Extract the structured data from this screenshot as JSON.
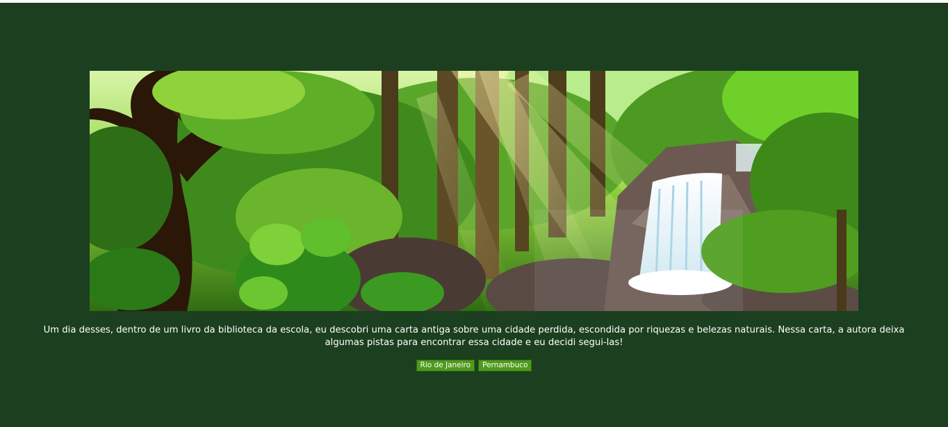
{
  "page": {
    "background": "#1c3f1f"
  },
  "illustration": {
    "description_icon": "rainforest-waterfall-image"
  },
  "story": {
    "text": "Um dia desses, dentro de um livro da biblioteca da escola, eu descobri uma carta antiga sobre uma cidade perdida, escondida por riquezas e belezas naturais. Nessa carta, a autora deixa algumas pistas para encontrar essa cidade e eu decidi segui-las!"
  },
  "choices": [
    {
      "label": "Rio de Janeiro"
    },
    {
      "label": "Pernambuco"
    }
  ],
  "colors": {
    "button": "#4f9a1d",
    "button_border": "#2f6d10",
    "text": "#ffffff"
  }
}
